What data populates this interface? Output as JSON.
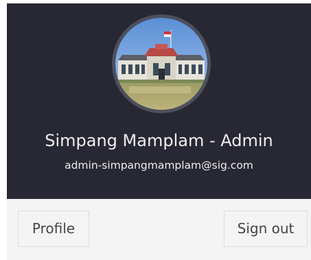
{
  "user": {
    "name": "Simpang Mamplam - Admin",
    "email": "admin-simpangmamplam@sig.com",
    "avatar_icon": "user-avatar-photo"
  },
  "footer": {
    "profile_label": "Profile",
    "signout_label": "Sign out"
  },
  "colors": {
    "header_bg": "#272833",
    "footer_bg": "#f4f4f4",
    "text_light": "#eeeeee",
    "button_text": "#444444"
  }
}
